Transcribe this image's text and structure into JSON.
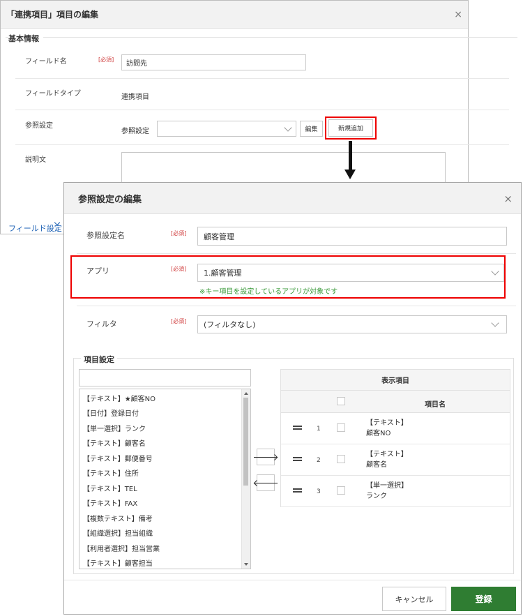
{
  "back_dialog": {
    "title": "「連携項目」項目の編集",
    "section": "基本情報",
    "required": "[必須]",
    "fields": {
      "name_label": "フィールド名",
      "name_value": "訪問先",
      "type_label": "フィールドタイプ",
      "type_value": "連携項目",
      "ref_label": "参照設定",
      "ref_inner_label": "参照設定",
      "ref_select_value": "",
      "edit_button": "編集",
      "new_button": "新規追加",
      "desc_label": "説明文"
    },
    "footer_link": "フィールド設定"
  },
  "front_dialog": {
    "title": "参照設定の編集",
    "required": "[必須]",
    "ref_name_label": "参照設定名",
    "ref_name_value": "顧客管理",
    "app_label": "アプリ",
    "app_value": "1.顧客管理",
    "app_note": "※キー項目を設定しているアプリが対象です",
    "filter_label": "フィルタ",
    "filter_value": "(フィルタなし)",
    "items_section": "項目設定",
    "search_value": "",
    "available_items": [
      "【テキスト】★顧客NO",
      "【日付】登録日付",
      "【単一選択】ランク",
      "【テキスト】顧客名",
      "【テキスト】郵便番号",
      "【テキスト】住所",
      "【テキスト】TEL",
      "【テキスト】FAX",
      "【複数テキスト】備考",
      "【組織選択】担当組織",
      "【利用者選択】担当営業",
      "【テキスト】顧客担当"
    ],
    "display_table": {
      "caption": "表示項目",
      "column": "項目名",
      "rows": [
        {
          "num": "1",
          "type": "【テキスト】",
          "name": "顧客NO"
        },
        {
          "num": "2",
          "type": "【テキスト】",
          "name": "顧客名"
        },
        {
          "num": "3",
          "type": "【単一選択】",
          "name": "ランク"
        }
      ]
    },
    "cancel_button": "キャンセル",
    "register_button": "登録"
  },
  "icons": {
    "close": "×",
    "move_right": "🡒",
    "move_left": "🡐"
  },
  "colors": {
    "highlight": "#e00000",
    "primary": "#2f7d32",
    "note": "#3a9a3a",
    "required": "#d04040",
    "link": "#1a5fb4"
  }
}
